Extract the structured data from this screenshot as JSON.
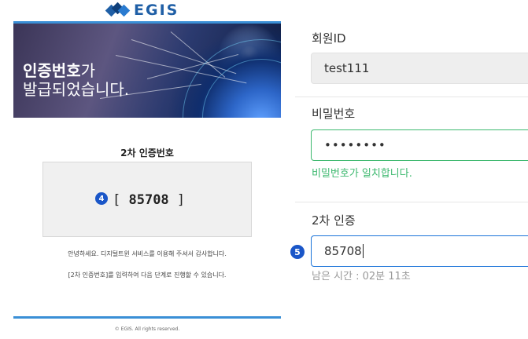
{
  "email": {
    "logo_text": "EGIS",
    "banner": {
      "title_bold": "인증번호",
      "title_rest": "가",
      "title_line2": "발급되었습니다."
    },
    "sub_title": "2차 인증번호",
    "code": "85708",
    "code_open": "[ ",
    "code_close": " ]",
    "message_1": "안녕하세요. 디지털트윈 서비스를 이용해 주셔서 감사합니다.",
    "message_2": "[2차 인증번호]를 입력하여 다음 단계로 진행할 수 있습니다.",
    "footer": "© EGIS. All rights reserved.",
    "colors": {
      "accent": "#3a8fd6",
      "brand": "#1f5fa6"
    }
  },
  "form": {
    "id_label": "회원ID",
    "id_value": "test111",
    "pw_label": "비밀번호",
    "pw_value": "••••••••",
    "pw_status": "비밀번호가 일치합니다.",
    "twofa_label": "2차 인증",
    "twofa_value": "85708",
    "timer_text": "남은 시간 : 02분 11초",
    "colors": {
      "valid": "#3cb86e",
      "focus": "#1a73d9"
    }
  },
  "markers": {
    "m4": "4",
    "m5": "5"
  }
}
